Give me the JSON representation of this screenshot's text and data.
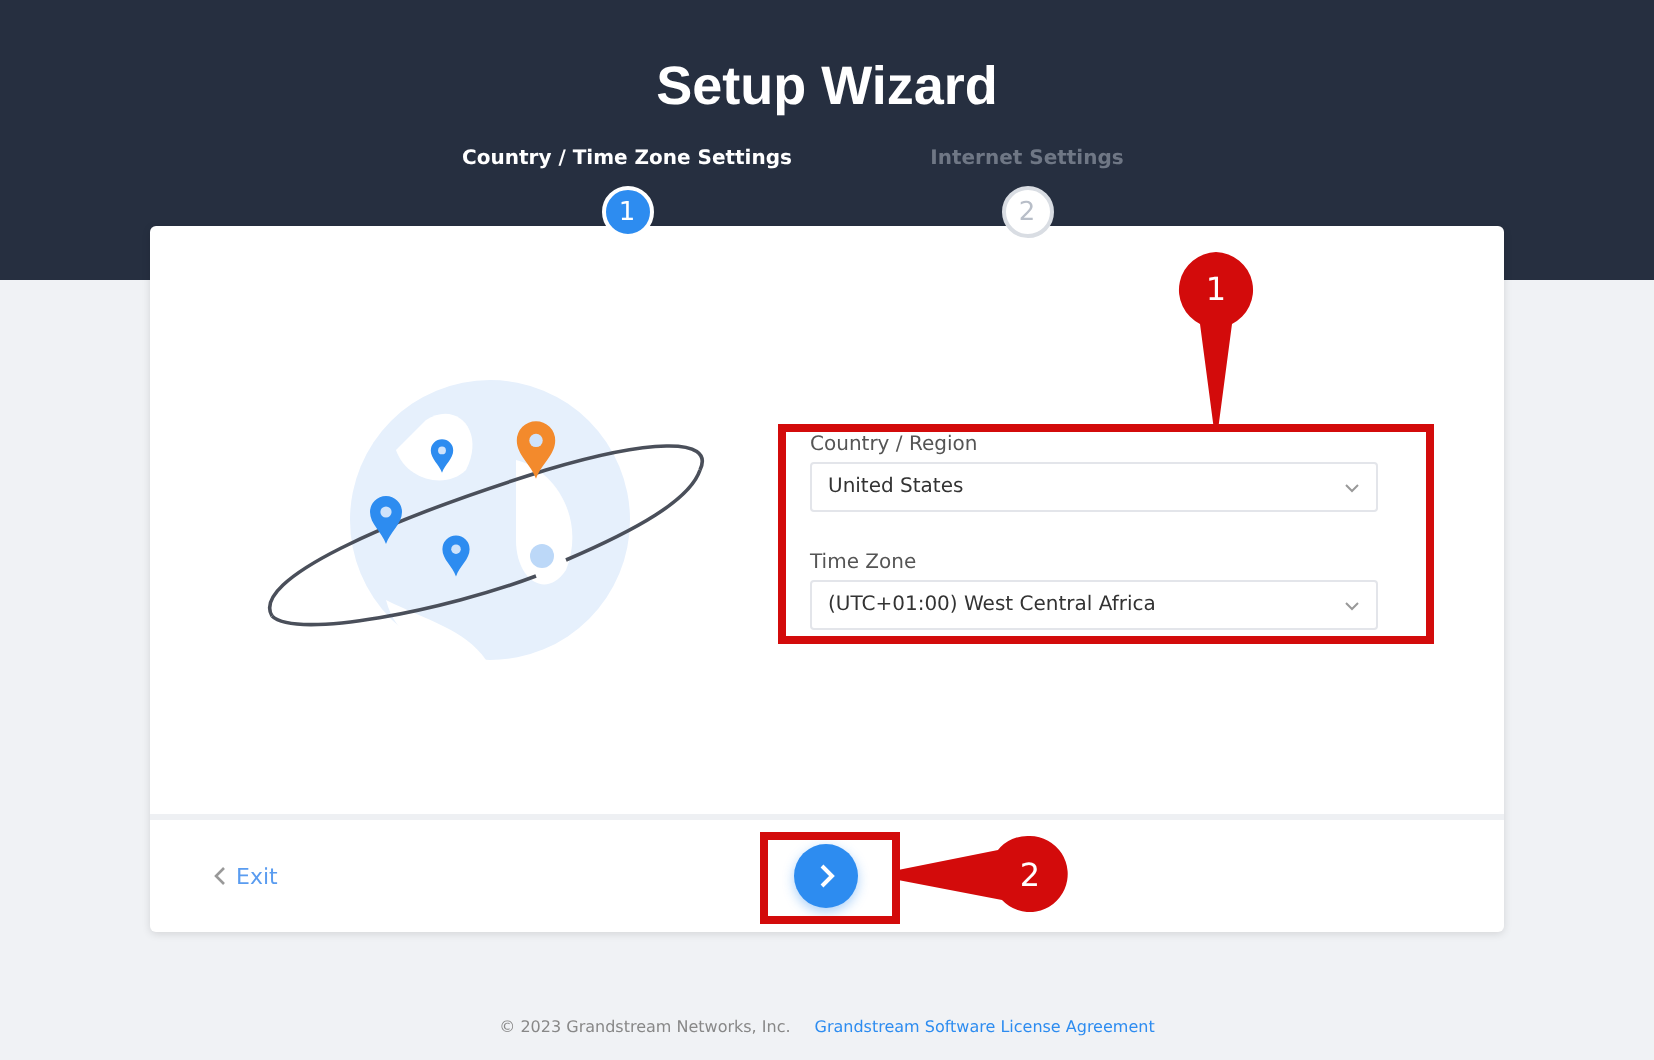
{
  "title": "Setup Wizard",
  "steps": [
    {
      "label": "Country / Time Zone Settings",
      "number": "1",
      "selected": true
    },
    {
      "label": "Internet Settings",
      "number": "2",
      "selected": false
    }
  ],
  "form": {
    "fields": [
      {
        "label": "Country / Region",
        "value": "United States"
      },
      {
        "label": "Time Zone",
        "value": "(UTC+01:00) West Central Africa"
      }
    ]
  },
  "footer_bar": {
    "exit": "Exit"
  },
  "annotations": [
    {
      "number": "1",
      "kind": "above"
    },
    {
      "number": "2",
      "kind": "beside"
    }
  ],
  "page_footer": {
    "copyright": "© 2023 Grandstream Networks, Inc.",
    "link": "Grandstream Software License Agreement"
  }
}
